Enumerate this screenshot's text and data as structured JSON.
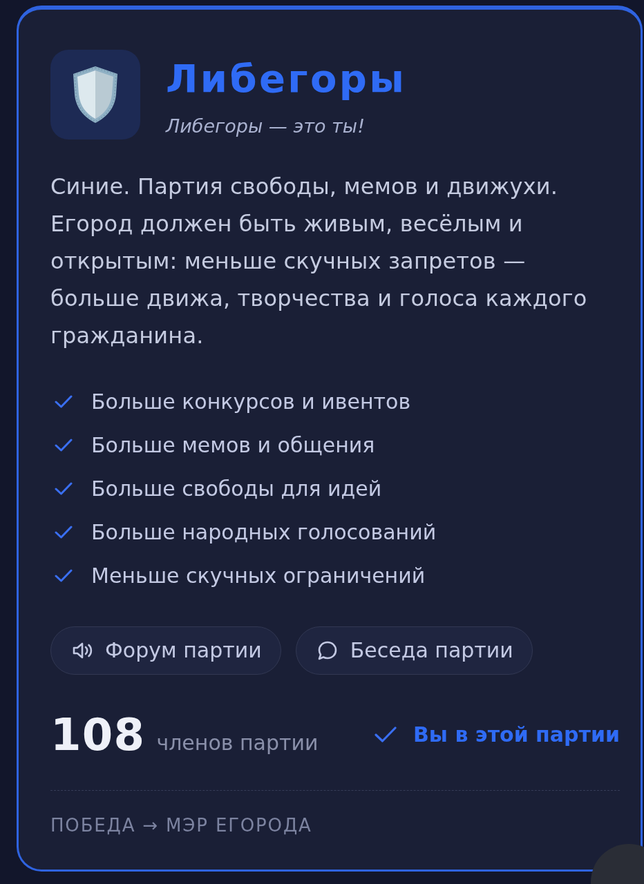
{
  "party": {
    "name": "Либегоры",
    "slogan": "Либегоры — это ты!",
    "description": "Синие. Партия свободы, мемов и движухи. Егород должен быть живым, весёлым и открытым: меньше скучных запретов — больше движа, творчества и голоса каждого гражданина."
  },
  "goals": [
    "Больше конкурсов и ивентов",
    "Больше мемов и общения",
    "Больше свободы для идей",
    "Больше народных голосований",
    "Меньше скучных ограничений"
  ],
  "buttons": [
    {
      "kind": "forum",
      "label": "Форум партии"
    },
    {
      "kind": "chat",
      "label": "Беседа партии"
    }
  ],
  "members": {
    "count": "108",
    "label": "членов партии"
  },
  "membership": {
    "joined": true,
    "label": "Вы в этой партии"
  },
  "footer": "ПОБЕДА → МЭР ЕГОРОДА"
}
